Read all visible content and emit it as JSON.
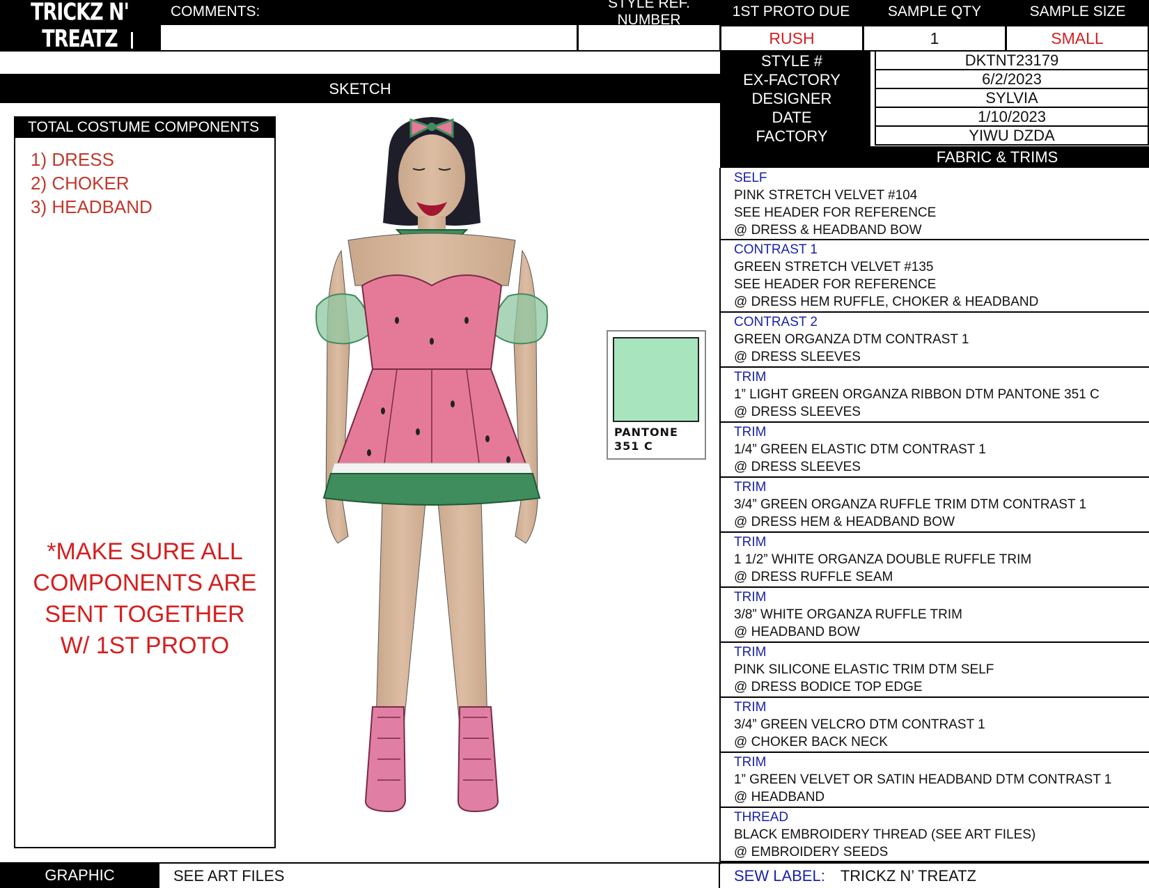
{
  "brand": {
    "logo": "TRICKZ N' TREATZ"
  },
  "header": {
    "comments_label": "COMMENTS:",
    "comments_value": "",
    "style_ref_label": "STYLE REF. NUMBER",
    "style_ref_value": "",
    "proto_due_label": "1ST PROTO DUE",
    "proto_due_value": "RUSH",
    "sample_qty_label": "SAMPLE QTY",
    "sample_qty_value": "1",
    "sample_size_label": "SAMPLE SIZE",
    "sample_size_value": "SMALL"
  },
  "sketch": {
    "title": "SKETCH"
  },
  "components": {
    "title": "TOTAL COSTUME COMPONENTS",
    "items": [
      "1) DRESS",
      "2) CHOKER",
      "3) HEADBAND"
    ],
    "notice_lines": [
      "*MAKE SURE ALL",
      "COMPONENTS ARE",
      "SENT TOGETHER",
      "W/ 1ST PROTO"
    ]
  },
  "info": {
    "style_label": "STYLE #",
    "style_value": "DKTNT23179",
    "exfactory_label": "EX-FACTORY",
    "exfactory_value": "6/2/2023",
    "designer_label": "DESIGNER",
    "designer_value": "SYLVIA",
    "date_label": "DATE",
    "date_value": "1/10/2023",
    "factory_label": "FACTORY",
    "factory_value": "YIWU DZDA"
  },
  "fabric": {
    "title": "FABRIC & TRIMS",
    "sections": [
      {
        "type": "SELF",
        "lines": [
          "PINK STRETCH VELVET #104",
          "SEE HEADER FOR REFERENCE",
          "@ DRESS & HEADBAND BOW"
        ]
      },
      {
        "type": "CONTRAST 1",
        "lines": [
          "GREEN STRETCH VELVET #135",
          "SEE HEADER FOR REFERENCE",
          "@ DRESS HEM RUFFLE, CHOKER & HEADBAND"
        ]
      },
      {
        "type": "CONTRAST 2",
        "lines": [
          "GREEN ORGANZA DTM CONTRAST 1",
          "@ DRESS SLEEVES"
        ]
      },
      {
        "type": "TRIM",
        "lines": [
          "1” LIGHT GREEN ORGANZA RIBBON DTM PANTONE 351 C",
          "@ DRESS SLEEVES"
        ]
      },
      {
        "type": "TRIM",
        "lines": [
          "1/4” GREEN ELASTIC DTM CONTRAST 1",
          "@ DRESS SLEEVES"
        ]
      },
      {
        "type": "TRIM",
        "lines": [
          "3/4” GREEN ORGANZA RUFFLE TRIM DTM CONTRAST 1",
          "@ DRESS HEM & HEADBAND BOW"
        ]
      },
      {
        "type": "TRIM",
        "lines": [
          "1 1/2” WHITE ORGANZA DOUBLE RUFFLE TRIM",
          "@ DRESS RUFFLE SEAM"
        ]
      },
      {
        "type": "TRIM",
        "lines": [
          "3/8” WHITE ORGANZA RUFFLE TRIM",
          "@ HEADBAND BOW"
        ]
      },
      {
        "type": "TRIM",
        "lines": [
          "PINK SILICONE ELASTIC TRIM DTM SELF",
          "@ DRESS BODICE TOP EDGE"
        ]
      },
      {
        "type": "TRIM",
        "lines": [
          "3/4” GREEN VELCRO DTM CONTRAST 1",
          "@ CHOKER BACK NECK"
        ]
      },
      {
        "type": "TRIM",
        "lines": [
          "1” GREEN VELVET OR SATIN HEADBAND DTM CONTRAST 1",
          "@ HEADBAND"
        ]
      },
      {
        "type": "THREAD",
        "lines": [
          "BLACK EMBROIDERY THREAD (SEE ART FILES)",
          "@ EMBROIDERY SEEDS"
        ]
      }
    ]
  },
  "swatch": {
    "line1": "PANTONE",
    "line2": "351 C",
    "color": "#a8e4bd"
  },
  "footer": {
    "graphic_label": "GRAPHIC",
    "graphic_value": "SEE ART FILES",
    "sew_label_label": "SEW LABEL:",
    "sew_label_value": "TRICKZ N’ TREATZ"
  },
  "colors": {
    "red": "#d41f1f",
    "blue": "#1a22a8",
    "dress_pink": "#e57a98",
    "dress_green": "#3f8c5c"
  }
}
